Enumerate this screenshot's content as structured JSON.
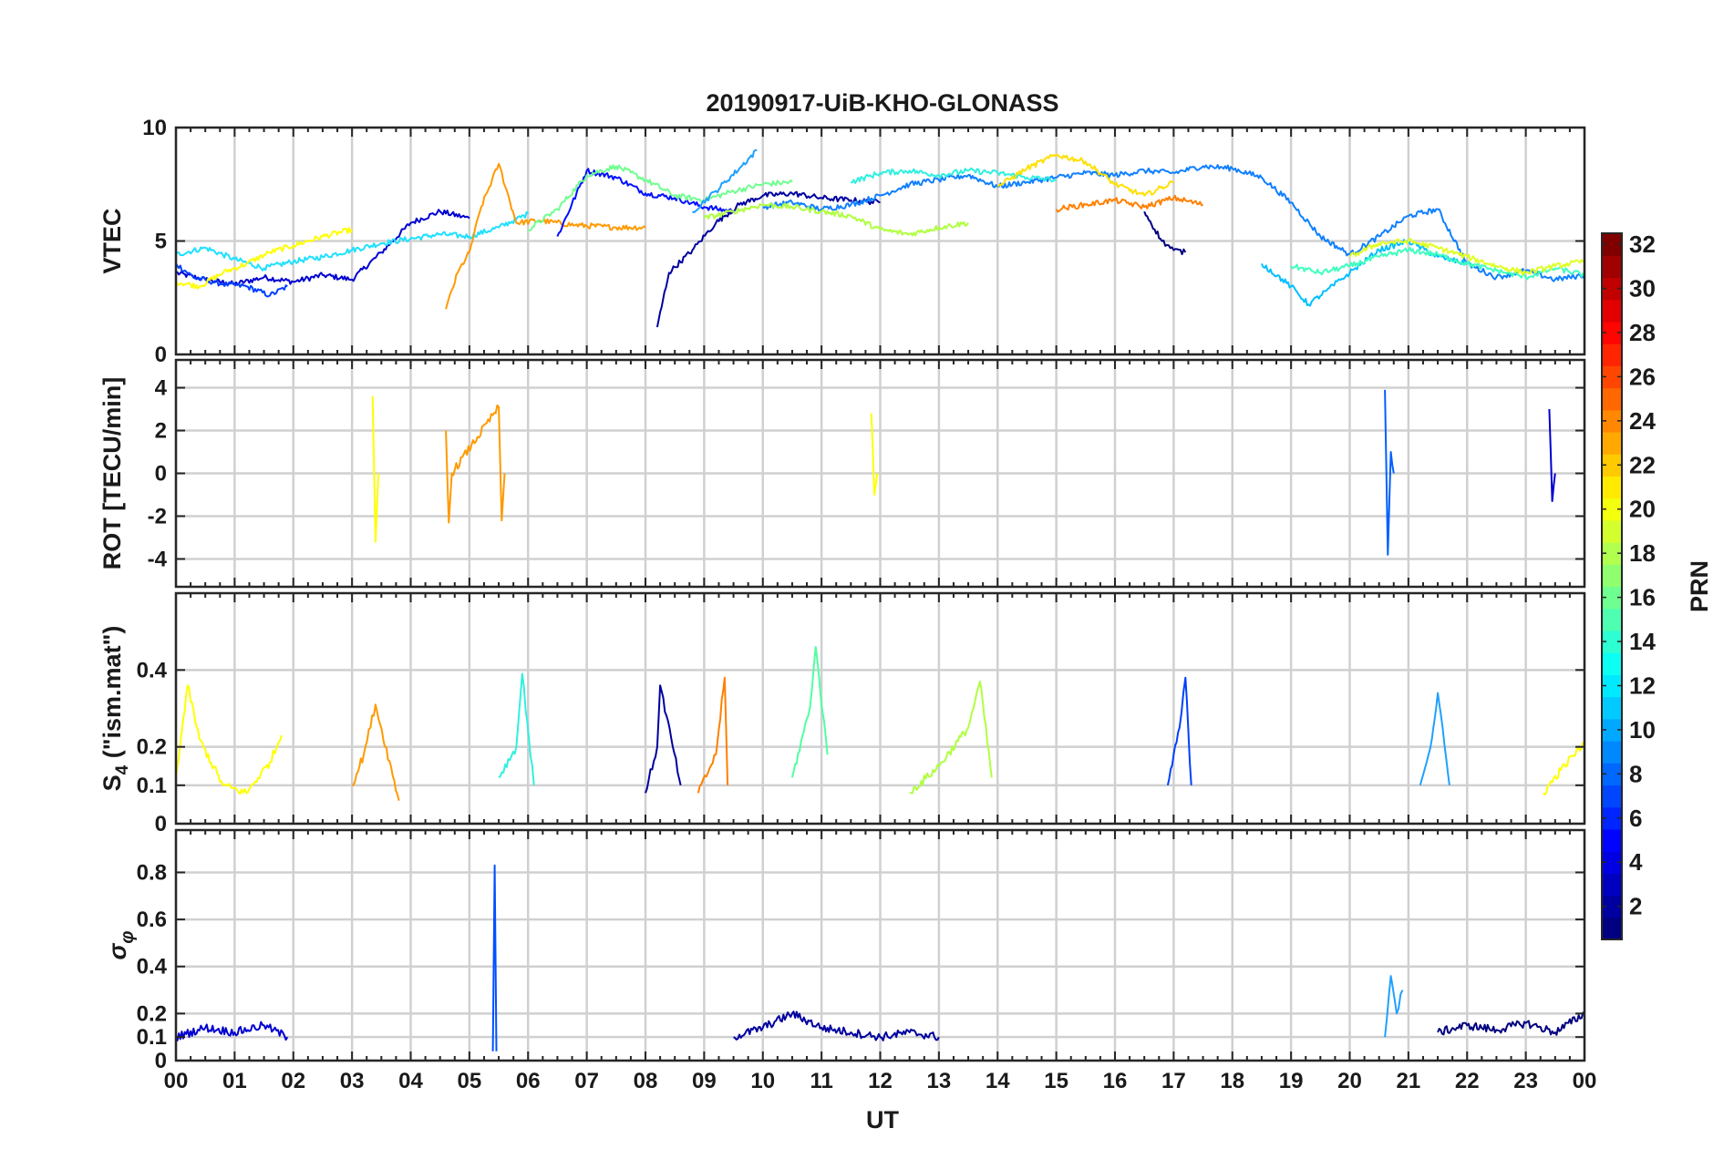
{
  "chart_data": {
    "type": "line",
    "title": "20190917-UiB-KHO-GLONASS",
    "xlabel": "UT",
    "x_ticks": [
      "00",
      "01",
      "02",
      "03",
      "04",
      "05",
      "06",
      "07",
      "08",
      "09",
      "10",
      "11",
      "12",
      "13",
      "14",
      "15",
      "16",
      "17",
      "18",
      "19",
      "20",
      "21",
      "22",
      "23",
      "00"
    ],
    "x_range_hours": [
      0,
      24
    ],
    "grid": true,
    "colorbar": {
      "label": "PRN",
      "range": [
        1,
        32
      ],
      "ticks": [
        "2",
        "4",
        "6",
        "8",
        "10",
        "12",
        "14",
        "16",
        "18",
        "20",
        "22",
        "24",
        "26",
        "28",
        "30",
        "32"
      ],
      "colormap": "jet",
      "placement": "right"
    },
    "panels": [
      {
        "id": "vtec",
        "ylabel": "VTEC",
        "ylim": [
          0,
          10
        ],
        "y_ticks": [
          "0",
          "5",
          "10"
        ],
        "series": [
          {
            "prn": 3,
            "color": "#0000d0",
            "x": [
              0,
              0.5,
              1,
              1.5,
              2,
              2.5,
              3,
              3.5,
              4,
              4.5,
              5
            ],
            "y": [
              3.6,
              3.3,
              3.1,
              3.4,
              3.2,
              3.5,
              3.3,
              4.5,
              5.8,
              6.3,
              6.0
            ]
          },
          {
            "prn": 5,
            "color": "#0040ff",
            "x": [
              0,
              0.3,
              0.8,
              1.2,
              1.6,
              1.9
            ],
            "y": [
              4.0,
              3.4,
              3.1,
              3.0,
              2.6,
              3.0
            ]
          },
          {
            "prn": 12,
            "color": "#20e0ff",
            "x": [
              0,
              0.5,
              1,
              1.5,
              2,
              2.5,
              3,
              3.5,
              4,
              4.5,
              5,
              5.5,
              6
            ],
            "y": [
              4.4,
              4.7,
              4.2,
              3.8,
              4.1,
              4.3,
              4.6,
              4.9,
              5.1,
              5.3,
              5.2,
              5.6,
              6.2
            ]
          },
          {
            "prn": 20,
            "color": "#ffff00",
            "x": [
              0,
              0.4,
              0.8,
              1.2,
              1.6,
              2,
              2.5,
              3
            ],
            "y": [
              3.2,
              3.0,
              3.6,
              4.0,
              4.5,
              4.8,
              5.2,
              5.5
            ]
          },
          {
            "prn": 22,
            "color": "#ff9a00",
            "x": [
              4.6,
              4.8,
              5,
              5.2,
              5.5,
              5.8,
              6.2,
              6.8,
              7.5,
              8
            ],
            "y": [
              2.0,
              3.6,
              4.5,
              6.5,
              8.4,
              5.8,
              5.9,
              5.7,
              5.6,
              5.6
            ]
          },
          {
            "prn": 4,
            "color": "#0010ff",
            "x": [
              6.5,
              7,
              7.5,
              8,
              8.5,
              9,
              9.5
            ],
            "y": [
              5.2,
              8.1,
              7.8,
              7.1,
              6.9,
              6.5,
              6.3
            ]
          },
          {
            "prn": 16,
            "color": "#70ff90",
            "x": [
              6,
              6.5,
              7,
              7.5,
              8,
              8.5,
              9,
              9.5,
              10,
              10.5
            ],
            "y": [
              5.5,
              6.4,
              7.9,
              8.3,
              7.7,
              7.0,
              6.8,
              7.2,
              7.5,
              7.6
            ]
          },
          {
            "prn": 2,
            "color": "#0000a0",
            "x": [
              8.2,
              8.4,
              8.8,
              9.2,
              9.6,
              10,
              10.5,
              11,
              11.5,
              12
            ],
            "y": [
              1.2,
              3.6,
              4.6,
              5.8,
              6.6,
              7.0,
              7.1,
              6.9,
              6.8,
              6.7
            ]
          },
          {
            "prn": 10,
            "color": "#20a0ff",
            "x": [
              8.8,
              9.2,
              9.6,
              9.9
            ],
            "y": [
              6.3,
              7.2,
              8.2,
              9.0
            ]
          },
          {
            "prn": 8,
            "color": "#1080ff",
            "x": [
              10,
              10.5,
              11,
              11.5,
              12,
              12.5,
              13,
              13.5,
              14,
              14.5,
              15,
              15.5,
              16,
              16.5,
              17,
              17.5,
              18,
              18.5,
              19,
              19.5,
              20,
              20.5,
              21,
              21.5,
              22,
              22.5,
              23,
              23.5,
              24
            ],
            "y": [
              6.5,
              6.7,
              6.4,
              6.6,
              7.0,
              7.5,
              7.7,
              7.9,
              7.4,
              7.6,
              7.8,
              8.0,
              7.9,
              8.1,
              8.0,
              8.3,
              8.2,
              7.8,
              6.7,
              5.2,
              4.4,
              5.2,
              6.1,
              6.4,
              4.0,
              3.4,
              3.7,
              3.3,
              3.5
            ]
          },
          {
            "prn": 13,
            "color": "#30f0e0",
            "x": [
              11.5,
              12,
              12.5,
              13,
              13.5,
              14,
              14.5,
              15
            ],
            "y": [
              7.6,
              8.0,
              8.1,
              7.9,
              8.1,
              8.0,
              7.8,
              7.7
            ]
          },
          {
            "prn": 18,
            "color": "#b0ff40",
            "x": [
              9,
              9.5,
              10,
              10.5,
              11,
              11.5,
              12,
              12.5,
              13,
              13.5
            ],
            "y": [
              6.0,
              6.3,
              6.6,
              6.5,
              6.3,
              6.1,
              5.5,
              5.3,
              5.6,
              5.8
            ]
          },
          {
            "prn": 21,
            "color": "#ffe000",
            "x": [
              14,
              14.5,
              15,
              15.5,
              16,
              16.5,
              17
            ],
            "y": [
              7.4,
              8.2,
              8.8,
              8.5,
              7.5,
              7.0,
              7.6
            ]
          },
          {
            "prn": 23,
            "color": "#ff8000",
            "x": [
              15,
              15.5,
              16,
              16.5,
              17,
              17.5
            ],
            "y": [
              6.4,
              6.6,
              6.8,
              6.5,
              6.9,
              6.6
            ]
          },
          {
            "prn": 1,
            "color": "#000080",
            "x": [
              16.5,
              16.8,
              17,
              17.2
            ],
            "y": [
              6.3,
              5.0,
              4.6,
              4.5
            ]
          },
          {
            "prn": 11,
            "color": "#00c0ff",
            "x": [
              18.5,
              19,
              19.3,
              19.6,
              20,
              20.5,
              21,
              21.5,
              22
            ],
            "y": [
              4.0,
              3.0,
              2.2,
              2.8,
              3.6,
              4.6,
              5.0,
              4.3,
              4.0
            ]
          },
          {
            "prn": 14,
            "color": "#40ffc0",
            "x": [
              19,
              19.5,
              20,
              20.5,
              21,
              21.5,
              22,
              22.5,
              23,
              23.5,
              24
            ],
            "y": [
              3.9,
              3.6,
              3.9,
              4.3,
              4.6,
              4.4,
              4.0,
              3.7,
              3.4,
              3.8,
              3.5
            ]
          },
          {
            "prn": 19,
            "color": "#e0ff20",
            "x": [
              20,
              20.5,
              21,
              21.5,
              22,
              22.5,
              23,
              23.5,
              24
            ],
            "y": [
              4.3,
              4.9,
              5.0,
              4.7,
              4.3,
              3.9,
              3.6,
              3.9,
              4.1
            ]
          }
        ]
      },
      {
        "id": "rot",
        "ylabel": "ROT [TECU/min]",
        "ylim": [
          -5.3,
          5.3
        ],
        "y_ticks": [
          "-4",
          "-2",
          "0",
          "2",
          "4"
        ],
        "series": [
          {
            "prn": 20,
            "color": "#ffff00",
            "x": [
              3.35,
              3.4,
              3.45
            ],
            "y": [
              3.6,
              -3.2,
              0
            ]
          },
          {
            "prn": 22,
            "color": "#ff9a00",
            "x": [
              4.6,
              4.65,
              4.7,
              5.5,
              5.55,
              5.6
            ],
            "y": [
              2.0,
              -2.3,
              0,
              3.1,
              -2.2,
              0
            ]
          },
          {
            "prn": 20,
            "color": "#ffff00",
            "x": [
              11.85,
              11.9,
              11.95
            ],
            "y": [
              2.8,
              -1.0,
              0
            ]
          },
          {
            "prn": 7,
            "color": "#0060ff",
            "x": [
              20.6,
              20.65,
              20.7,
              20.75
            ],
            "y": [
              3.9,
              -3.8,
              1.0,
              0
            ]
          },
          {
            "prn": 3,
            "color": "#0000d0",
            "x": [
              23.4,
              23.45,
              23.5
            ],
            "y": [
              3.0,
              -1.3,
              0
            ]
          }
        ]
      },
      {
        "id": "s4",
        "ylabel": "S4 (\"ism.mat\")",
        "ylim": [
          0,
          0.6
        ],
        "y_ticks": [
          "0",
          "0.1",
          "0.2",
          "0.4"
        ],
        "series": [
          {
            "prn": 20,
            "color": "#ffff00",
            "x": [
              0,
              0.2,
              0.4,
              0.8,
              1.2,
              1.6,
              1.8
            ],
            "y": [
              0.12,
              0.36,
              0.22,
              0.1,
              0.08,
              0.16,
              0.23
            ]
          },
          {
            "prn": 22,
            "color": "#ff9a00",
            "x": [
              3,
              3.2,
              3.4,
              3.8
            ],
            "y": [
              0.1,
              0.18,
              0.31,
              0.06
            ]
          },
          {
            "prn": 13,
            "color": "#30f0e0",
            "x": [
              5.5,
              5.8,
              5.9,
              6.1
            ],
            "y": [
              0.12,
              0.2,
              0.39,
              0.1
            ]
          },
          {
            "prn": 2,
            "color": "#0000a0",
            "x": [
              8,
              8.2,
              8.25,
              8.6
            ],
            "y": [
              0.08,
              0.2,
              0.36,
              0.1
            ]
          },
          {
            "prn": 23,
            "color": "#ff8000",
            "x": [
              8.9,
              9.2,
              9.35,
              9.4
            ],
            "y": [
              0.08,
              0.18,
              0.38,
              0.1
            ]
          },
          {
            "prn": 15,
            "color": "#50ffa0",
            "x": [
              10.5,
              10.8,
              10.9,
              11.1
            ],
            "y": [
              0.12,
              0.3,
              0.46,
              0.18
            ]
          },
          {
            "prn": 18,
            "color": "#b0ff40",
            "x": [
              12.5,
              13,
              13.5,
              13.7,
              13.9
            ],
            "y": [
              0.08,
              0.15,
              0.25,
              0.37,
              0.12
            ]
          },
          {
            "prn": 5,
            "color": "#0040ff",
            "x": [
              16.9,
              17.1,
              17.2,
              17.3
            ],
            "y": [
              0.1,
              0.25,
              0.38,
              0.1
            ]
          },
          {
            "prn": 10,
            "color": "#20a0ff",
            "x": [
              21.2,
              21.4,
              21.5,
              21.7
            ],
            "y": [
              0.1,
              0.22,
              0.34,
              0.1
            ]
          },
          {
            "prn": 20,
            "color": "#ffff00",
            "x": [
              23.3,
              23.6,
              24
            ],
            "y": [
              0.08,
              0.14,
              0.21
            ]
          }
        ]
      },
      {
        "id": "sigphi",
        "ylabel": "σφ",
        "ylim": [
          0,
          0.98
        ],
        "y_ticks": [
          "0",
          "0.1",
          "0.2",
          "0.4",
          "0.6",
          "0.8"
        ],
        "series": [
          {
            "prn": 3,
            "color": "#0000d0",
            "x": [
              0,
              0.5,
              1,
              1.5,
              1.9
            ],
            "y": [
              0.1,
              0.14,
              0.12,
              0.15,
              0.1
            ]
          },
          {
            "prn": 6,
            "color": "#0050ff",
            "x": [
              5.4,
              5.43,
              5.46
            ],
            "y": [
              0.04,
              0.83,
              0.04
            ]
          },
          {
            "prn": 2,
            "color": "#0000a0",
            "x": [
              9.5,
              10,
              10.5,
              11,
              11.5,
              12,
              12.5,
              13
            ],
            "y": [
              0.1,
              0.14,
              0.2,
              0.14,
              0.12,
              0.1,
              0.12,
              0.1
            ]
          },
          {
            "prn": 10,
            "color": "#20a0ff",
            "x": [
              20.6,
              20.7,
              20.8,
              20.9
            ],
            "y": [
              0.1,
              0.36,
              0.2,
              0.3
            ]
          },
          {
            "prn": 1,
            "color": "#000080",
            "x": [
              21.5,
              22,
              22.5,
              23,
              23.5,
              24
            ],
            "y": [
              0.12,
              0.15,
              0.13,
              0.16,
              0.12,
              0.2
            ]
          }
        ]
      }
    ]
  }
}
